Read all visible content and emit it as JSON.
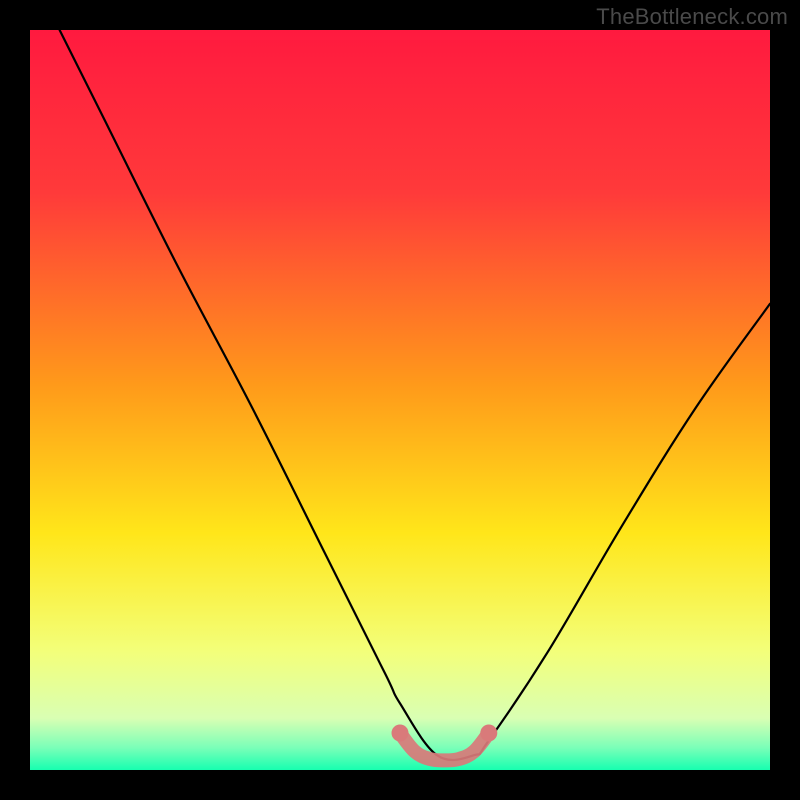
{
  "watermark": {
    "text": "TheBottleneck.com"
  },
  "chart_data": {
    "type": "line",
    "title": "",
    "xlabel": "",
    "ylabel": "",
    "xlim": [
      0,
      100
    ],
    "ylim": [
      0,
      100
    ],
    "grid": false,
    "legend": "none",
    "series": [
      {
        "name": "bottleneck-curve",
        "x": [
          4,
          10,
          20,
          30,
          40,
          48,
          50,
          55,
          60,
          62,
          70,
          80,
          90,
          100
        ],
        "values": [
          100,
          88,
          68,
          49,
          29,
          13,
          9,
          2,
          2,
          4,
          16,
          33,
          49,
          63
        ]
      }
    ],
    "highlight": {
      "name": "sweet-spot-band",
      "x": [
        50,
        52,
        54,
        56,
        58,
        60,
        62
      ],
      "values": [
        5,
        2.5,
        1.5,
        1.3,
        1.5,
        2.5,
        5
      ]
    },
    "gradient_stops": [
      {
        "pct": 0,
        "color": "#ff1a3f"
      },
      {
        "pct": 22,
        "color": "#ff3a3a"
      },
      {
        "pct": 48,
        "color": "#ff9a1a"
      },
      {
        "pct": 68,
        "color": "#ffe61a"
      },
      {
        "pct": 84,
        "color": "#f3ff7a"
      },
      {
        "pct": 93,
        "color": "#d9ffb3"
      },
      {
        "pct": 97,
        "color": "#7affb8"
      },
      {
        "pct": 100,
        "color": "#17ffb0"
      }
    ]
  }
}
